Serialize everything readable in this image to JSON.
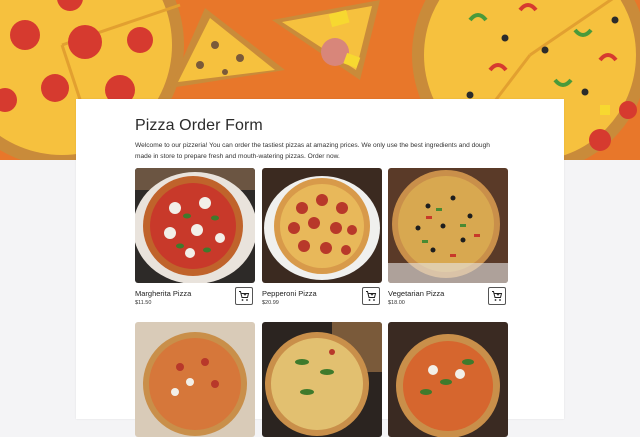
{
  "form": {
    "title": "Pizza Order Form",
    "description": "Welcome to our pizzeria! You can order the tastiest pizzas at amazing prices. We only use the best ingredients and dough made in store to prepare fresh and mouth-watering pizzas. Order now."
  },
  "products": [
    {
      "name": "Margherita Pizza",
      "price": "$11.50"
    },
    {
      "name": "Pepperoni Pizza",
      "price": "$20.99"
    },
    {
      "name": "Vegetarian Pizza",
      "price": "$18.00"
    }
  ],
  "icons": {
    "cart": "add-to-cart-icon"
  },
  "colors": {
    "banner": "#e8772a",
    "page_background": "#f4f4f6",
    "card": "#ffffff",
    "text": "#2b2b2b"
  }
}
